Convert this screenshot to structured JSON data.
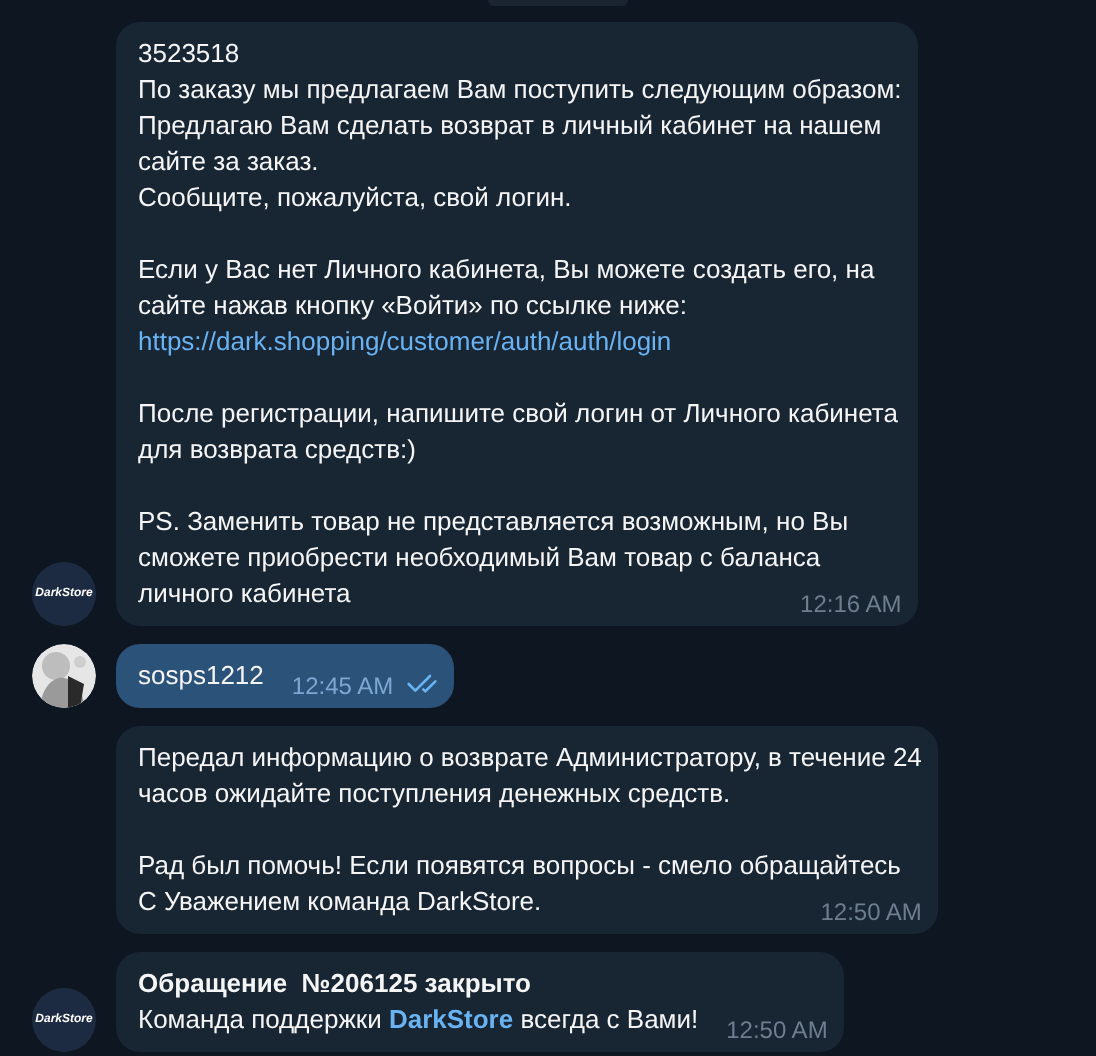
{
  "messages": [
    {
      "kind": "incoming",
      "avatar": {
        "kind": "logo",
        "label": "DarkStore"
      },
      "time": "12:16 AM",
      "paragraphs": [
        [
          [
            {
              "text": "3523518",
              "kind": "plain"
            }
          ],
          [
            {
              "text": "По заказу мы предлагаем Вам поступить следующим образом:",
              "kind": "plain"
            }
          ],
          [
            {
              "text": "Предлагаю Вам сделать возврат в личный кабинет на нашем",
              "kind": "plain"
            }
          ],
          [
            {
              "text": "сайте за заказ.",
              "kind": "plain"
            }
          ],
          [
            {
              "text": "Сообщите, пожалуйста, свой логин.",
              "kind": "plain"
            }
          ]
        ],
        [
          [
            {
              "text": "Если у Вас нет Личного кабинета, Вы можете создать его, на",
              "kind": "plain"
            }
          ],
          [
            {
              "text": "сайте нажав кнопку «Войти» по ссылке ниже:",
              "kind": "plain"
            }
          ],
          [
            {
              "text": "https://dark.shopping/customer/auth/auth/login",
              "kind": "link"
            }
          ]
        ],
        [
          [
            {
              "text": "После регистрации, напишите свой логин от Личного кабинета",
              "kind": "plain"
            }
          ],
          [
            {
              "text": "для возврата средств:)",
              "kind": "plain"
            }
          ]
        ],
        [
          [
            {
              "text": "PS. Заменить товар не представляется возможным, но Вы",
              "kind": "plain"
            }
          ],
          [
            {
              "text": "сможете приобрести необходимый Вам товар с баланса",
              "kind": "plain"
            }
          ],
          [
            {
              "text": "личного кабинета",
              "kind": "plain"
            }
          ]
        ]
      ]
    },
    {
      "kind": "outgoing",
      "avatar": {
        "kind": "picture"
      },
      "time": "12:45 AM",
      "read": true,
      "paragraphs": [
        [
          [
            {
              "text": "sosps1212",
              "kind": "plain"
            }
          ]
        ]
      ]
    },
    {
      "kind": "incoming",
      "avatar": {
        "kind": "none"
      },
      "time": "12:50 AM",
      "paragraphs": [
        [
          [
            {
              "text": "Передал информацию о возврате Администратору, в течение 24",
              "kind": "plain"
            }
          ],
          [
            {
              "text": "часов ожидайте поступления денежных средств.",
              "kind": "plain"
            }
          ]
        ],
        [
          [
            {
              "text": "Рад был помочь! Если появятся вопросы - смело обращайтесь",
              "kind": "plain"
            }
          ],
          [
            {
              "text": "С Уважением команда DarkStore.",
              "kind": "plain"
            }
          ]
        ]
      ]
    },
    {
      "kind": "incoming",
      "avatar": {
        "kind": "logo",
        "label": "DarkStore"
      },
      "time": "12:50 AM",
      "paragraphs": [
        [
          [
            {
              "text": "Обращение  №206125 закрыто",
              "kind": "bold"
            }
          ],
          [
            {
              "text": "Команда поддержки ",
              "kind": "plain"
            },
            {
              "text": "DarkStore",
              "kind": "highlight"
            },
            {
              "text": " всегда с Вами!",
              "kind": "plain"
            }
          ]
        ]
      ]
    }
  ]
}
